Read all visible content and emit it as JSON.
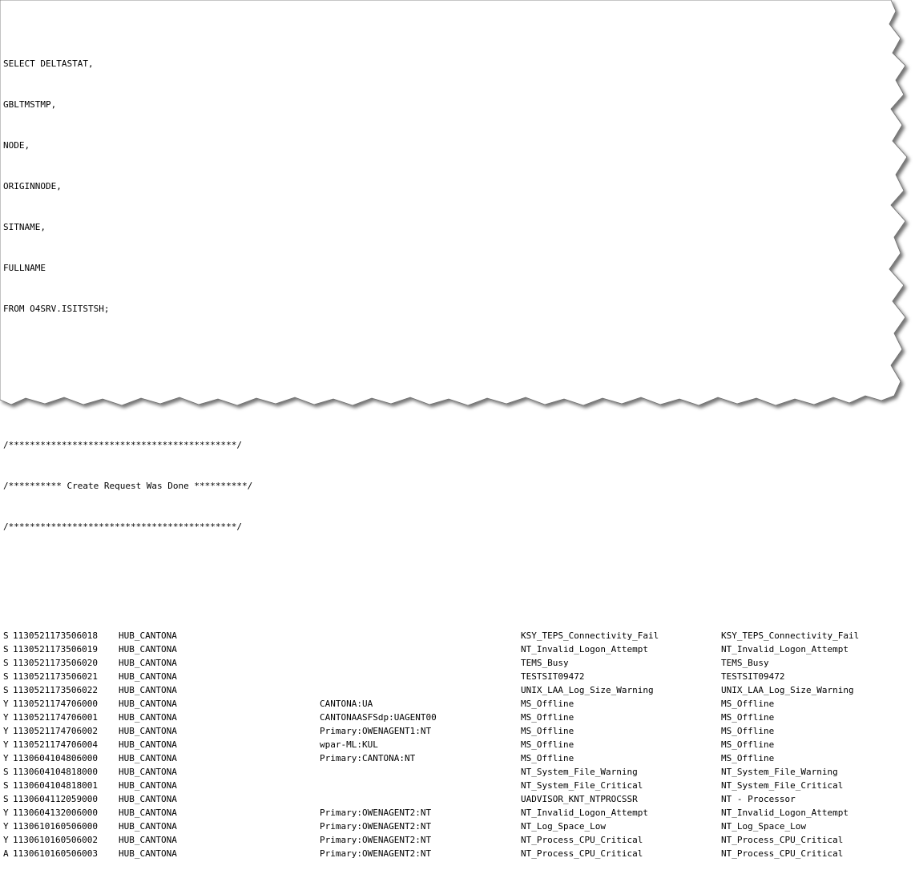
{
  "sql": {
    "lines": [
      "SELECT DELTASTAT,",
      "GBLTMSTMP,",
      "NODE,",
      "ORIGINNODE,",
      "SITNAME,",
      "FULLNAME",
      "FROM O4SRV.ISITSTSH;"
    ]
  },
  "comment": {
    "lines": [
      "/*******************************************/",
      "/********** Create Request Was Done **********/",
      "/*******************************************/"
    ]
  },
  "rows": [
    {
      "status": "S",
      "stamp": "1130521173506018",
      "node": "HUB_CANTONA",
      "origin": "",
      "sitname": "KSY_TEPS_Connectivity_Fail",
      "fullname": "KSY_TEPS_Connectivity_Fail"
    },
    {
      "status": "S",
      "stamp": "1130521173506019",
      "node": "HUB_CANTONA",
      "origin": "",
      "sitname": "NT_Invalid_Logon_Attempt",
      "fullname": "NT_Invalid_Logon_Attempt"
    },
    {
      "status": "S",
      "stamp": "1130521173506020",
      "node": "HUB_CANTONA",
      "origin": "",
      "sitname": "TEMS_Busy",
      "fullname": "TEMS_Busy"
    },
    {
      "status": "S",
      "stamp": "1130521173506021",
      "node": "HUB_CANTONA",
      "origin": "",
      "sitname": "TESTSIT09472",
      "fullname": "TESTSIT09472"
    },
    {
      "status": "S",
      "stamp": "1130521173506022",
      "node": "HUB_CANTONA",
      "origin": "",
      "sitname": "UNIX_LAA_Log_Size_Warning",
      "fullname": "UNIX_LAA_Log_Size_Warning"
    },
    {
      "status": "Y",
      "stamp": "1130521174706000",
      "node": "HUB_CANTONA",
      "origin": "CANTONA:UA",
      "sitname": "MS_Offline",
      "fullname": "MS_Offline"
    },
    {
      "status": "Y",
      "stamp": "1130521174706001",
      "node": "HUB_CANTONA",
      "origin": "CANTONAASFSdp:UAGENT00",
      "sitname": "MS_Offline",
      "fullname": "MS_Offline"
    },
    {
      "status": "Y",
      "stamp": "1130521174706002",
      "node": "HUB_CANTONA",
      "origin": "Primary:OWENAGENT1:NT",
      "sitname": "MS_Offline",
      "fullname": "MS_Offline"
    },
    {
      "status": "Y",
      "stamp": "1130521174706004",
      "node": "HUB_CANTONA",
      "origin": "wpar-ML:KUL",
      "sitname": "MS_Offline",
      "fullname": "MS_Offline"
    },
    {
      "status": "Y",
      "stamp": "1130604104806000",
      "node": "HUB_CANTONA",
      "origin": "Primary:CANTONA:NT",
      "sitname": "MS_Offline",
      "fullname": "MS_Offline"
    },
    {
      "status": "S",
      "stamp": "1130604104818000",
      "node": "HUB_CANTONA",
      "origin": "",
      "sitname": "NT_System_File_Warning",
      "fullname": "NT_System_File_Warning"
    },
    {
      "status": "S",
      "stamp": "1130604104818001",
      "node": "HUB_CANTONA",
      "origin": "",
      "sitname": "NT_System_File_Critical",
      "fullname": "NT_System_File_Critical"
    },
    {
      "status": "S",
      "stamp": "1130604112059000",
      "node": "HUB_CANTONA",
      "origin": "",
      "sitname": "UADVISOR_KNT_NTPROCSSR",
      "fullname": "NT - Processor"
    },
    {
      "status": "Y",
      "stamp": "1130604132006000",
      "node": "HUB_CANTONA",
      "origin": "Primary:OWENAGENT2:NT",
      "sitname": "NT_Invalid_Logon_Attempt",
      "fullname": "NT_Invalid_Logon_Attempt"
    },
    {
      "status": "Y",
      "stamp": "1130610160506000",
      "node": "HUB_CANTONA",
      "origin": "Primary:OWENAGENT2:NT",
      "sitname": "NT_Log_Space_Low",
      "fullname": "NT_Log_Space_Low"
    },
    {
      "status": "Y",
      "stamp": "1130610160506002",
      "node": "HUB_CANTONA",
      "origin": "Primary:OWENAGENT2:NT",
      "sitname": "NT_Process_CPU_Critical",
      "fullname": "NT_Process_CPU_Critical"
    },
    {
      "status": "A",
      "stamp": "1130610160506003",
      "node": "HUB_CANTONA",
      "origin": "Primary:OWENAGENT2:NT",
      "sitname": "NT_Process_CPU_Critical",
      "fullname": "NT_Process_CPU_Critical"
    }
  ]
}
